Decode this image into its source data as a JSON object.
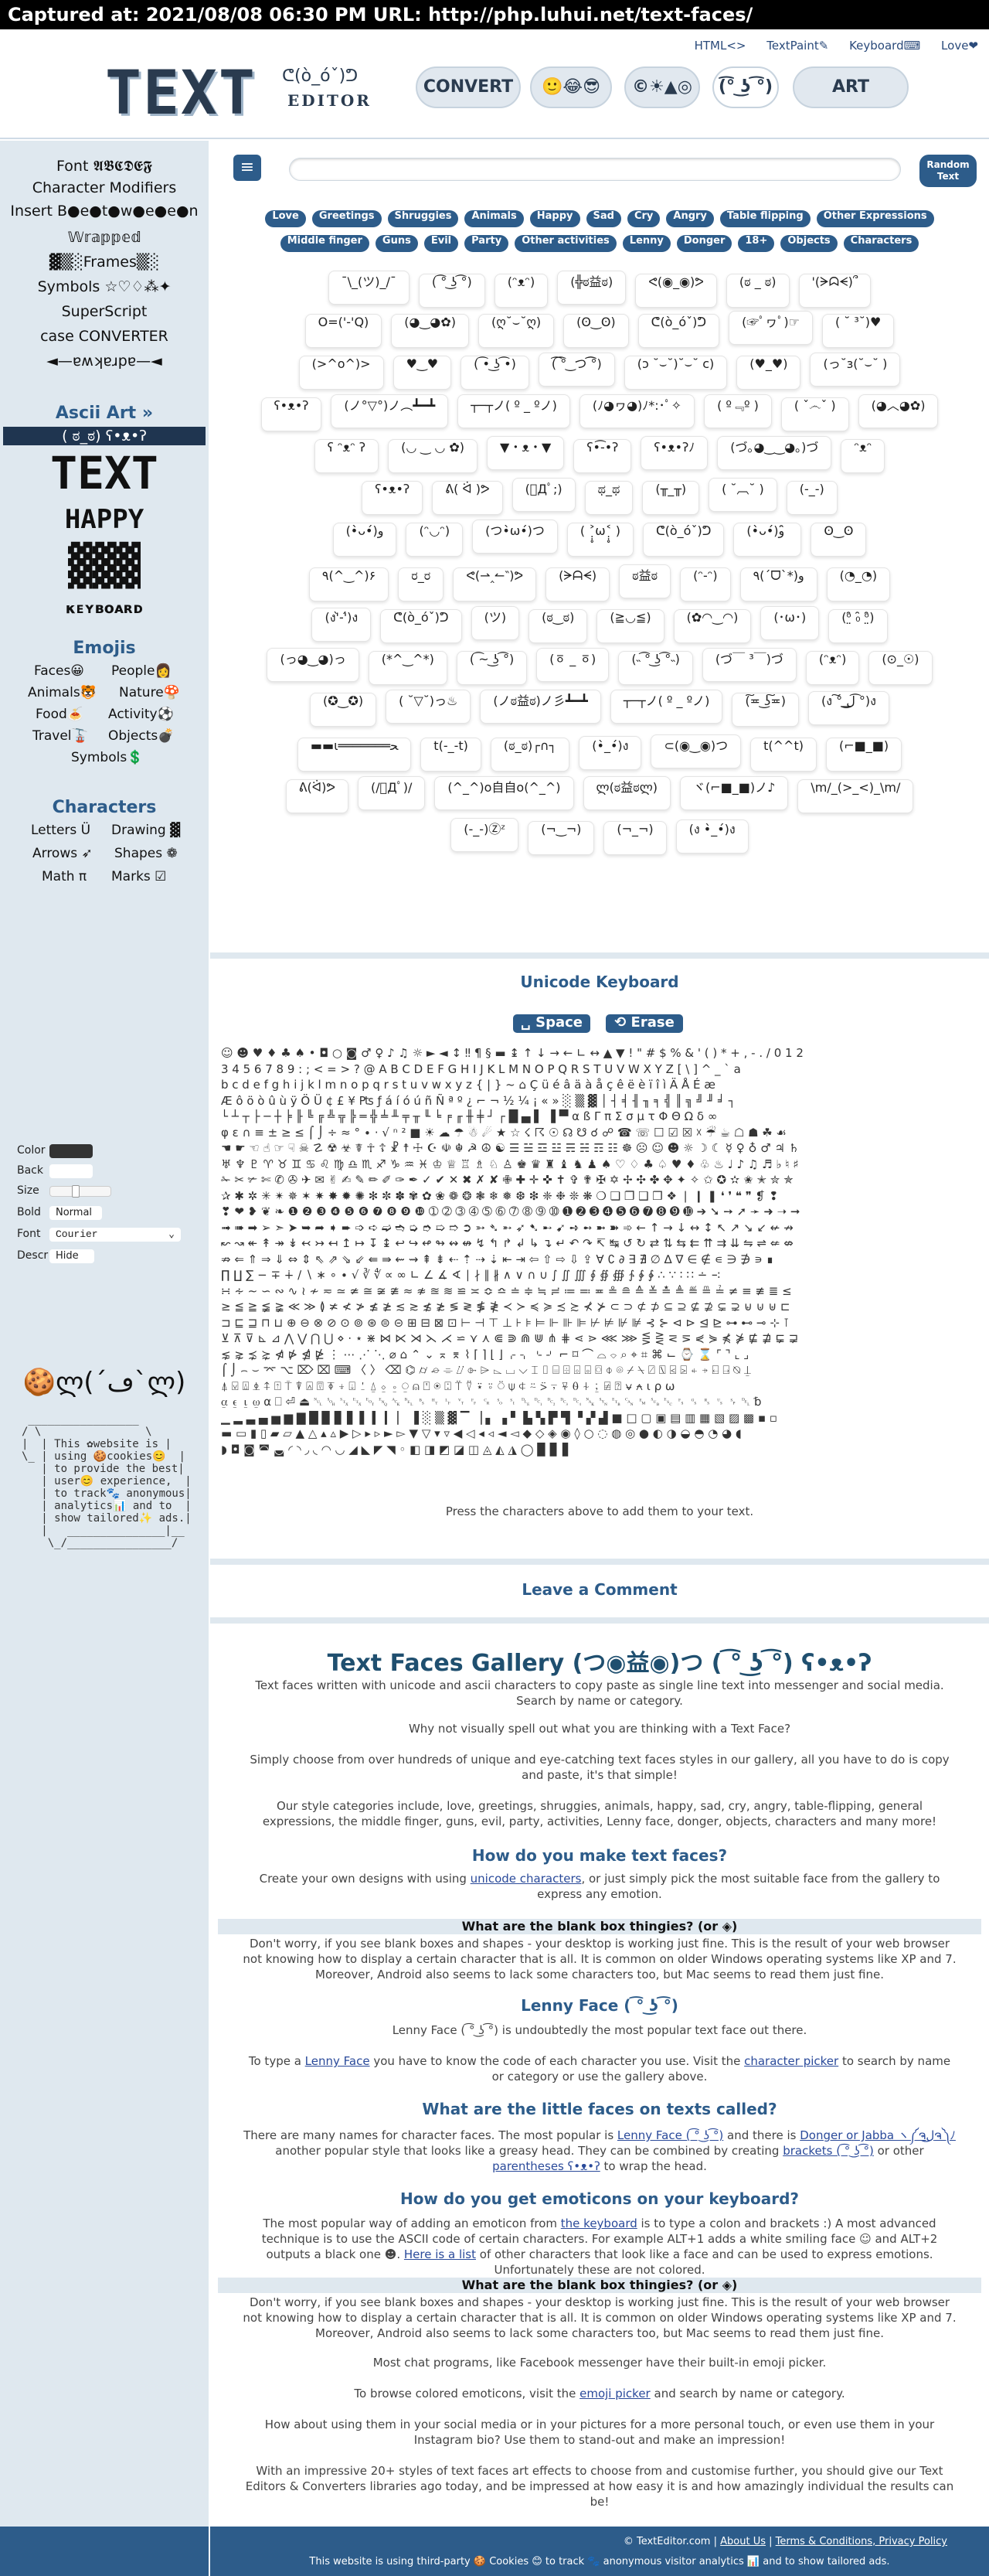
{
  "capture": {
    "text": "Captured at: 2021/08/08 06:30 PM    URL: http://php.luhui.net/text-faces/"
  },
  "header": {
    "links": [
      "HTML<>",
      "TextPaint✎",
      "Keyboard⌨",
      "Love❤"
    ],
    "logo_main": "TEXT",
    "logo_face": "ᕦ(ò_óˇ)ᕤ",
    "logo_sub": "EDITOR",
    "nav": [
      "CONVERT",
      "🙂😂😎",
      "©☀▲◎",
      "(͡° ͜ʖ ͡°)",
      "ART"
    ]
  },
  "sidebar": {
    "modifiers": [
      "Font 𝕬𝕭𝕮𝕯𝕰𝕱",
      "Character Modifiers",
      "Insert B●e●t●w●e●e●n",
      "𝕎𝕣𝕒𝕡𝕡𝕖𝕕",
      "▓▒░Frames▒░",
      "Symbols ☆♡♢⁂✦",
      "SuperScript",
      "case CONVERTER",
      "◄—ɐʍʞɐɹpɐ—◄"
    ],
    "ascii_title": "Ascii Art »",
    "ascii_highlight": "( ಠ_ಠ)  ʕ•ᴥ•ʔ",
    "ascii_items": [
      "TEXT",
      "HAPPY",
      "▓▓▓",
      "κᴇʏʙᴏᴀʀᴅ"
    ],
    "emojis_title": "Emojis",
    "emoji_items": [
      "Faces😀",
      "People👩",
      "Animals🐯",
      "Nature🍄",
      "Food🍝",
      "Activity⚽",
      "Travel🚡",
      "Objects💣",
      "Symbols💲"
    ],
    "chars_title": "Characters",
    "char_items": [
      "Letters Ü",
      "Drawing ▓",
      "Arrows ➶",
      "Shapes ❁",
      "Math π",
      "Marks ☑"
    ],
    "controls": {
      "color_label": "Color",
      "back_label": "Back",
      "size_label": "Size",
      "bold_label": "Bold",
      "bold_value": "Normal",
      "font_label": "Font",
      "font_value": "Courier",
      "descr_label": "Descr",
      "descr_value": "Hide"
    },
    "cookie_face": "🍪ლ(´ڡ`ლ)",
    "cookie_text": " _________________\n/ \\                \\\n|  | This ✿website is |\n\\_ | using 🍪cookies😊  |\n   | to provide the best|\n   | user😊 experience,  |\n   | to track🐾 anonymous|\n   | analytics📊 and to  |\n   | show tailored✨ ads.|\n   |   _______________|__\n    \\_/________________/"
  },
  "search": {
    "placeholder": ""
  },
  "random_button": "Random Text",
  "tags_row1": [
    "Love",
    "Greetings",
    "Shruggies",
    "Animals",
    "Happy",
    "Sad",
    "Cry",
    "Angry",
    "Table flipping",
    "Other Expressions"
  ],
  "tags_row2": [
    "Middle finger",
    "Guns",
    "Evil",
    "Party",
    "Other activities",
    "Lenny",
    "Donger",
    "18+",
    "Objects",
    "Characters"
  ],
  "faces": [
    [
      "¯\\_(ツ)_/¯",
      "( ͡° ͜ʖ ͡°)",
      "(ᵔᴥᵔ)",
      "(╬ಠ益ಠ)",
      "ᕙ(◉_◉)ᕗ",
      "(ಠ _ ಠ)",
      "'(ᗒᗣᗕ)՞"
    ],
    [
      "O=('-'Q)",
      "(◕‿◕✿)",
      "(ღ˘⌣˘ღ)",
      "(ʘ‿ʘ)",
      "ᕦ(ò_óˇ)ᕤ",
      "(☞ﾟヮﾟ)☞",
      "( ˘ ³˘)♥"
    ],
    [
      "(>^o^)>",
      "♥‿♥",
      "( ͡• ͜ʖ ͡•)",
      "(͡ ͡° ͜ つ ͡͡°)",
      "(ɔ ˘⌣˘)˘⌣˘ c)",
      "(♥_♥)",
      "(っ˘з(˘⌣˘ )"
    ],
    [
      "ʕ•ᴥ•ʔ",
      "(ノ°▽°)ノ︵┻━┻",
      "┬─┬ノ( º _ ºノ)",
      "(ﾉ◕ヮ◕)ﾉ*:･ﾟ✧",
      "( º﹃º )",
      "( ˇ෴ˇ )",
      "(◕︿◕✿)"
    ],
    [
      "ʕ ᵔᴥᵔ ʔ",
      "(◡ ‿ ◡ ✿)",
      "▼・ᴥ・▼",
      "ʕ•͡-•ʔ",
      "ʕ•ᴥ•ʔﾉ",
      "(づ｡◕‿‿◕｡)づ",
      "ᵔᴥᵔ"
    ],
    [
      "ʕ•ᴥ•ʔ",
      "ᕕ( ᐛ )ᕗ",
      "(ﾟДﾟ;)",
      "ಥ_ಥ",
      "(╥_╥)",
      "( ˘︹˘ )",
      "(-_-)"
    ],
    [
      "(•̀ᴗ•́)و",
      "(ᵔ◡ᵔ)",
      "(つ•̀ω•́)つ",
      "( ˃̣̣̥ω˂̣̣̥ )",
      "ᕦ(ò_óˇ)ᕤ",
      "(•̀ᴗ•́)و ̑̑",
      "ʘ‿ʘ"
    ],
    [
      "٩(^‿^)۶",
      "ರ_ರ",
      "ᕙ(⇀‸↼‶)ᕗ",
      "(ᗒᗩᗕ)",
      "ಠ益ಠ",
      "(ᵔ-ᵔ)",
      "٩(ˊᗜˋ*)و",
      "(◔_◔)"
    ],
    [
      "(ง'̀-'́)ง",
      "ᕦ(ò_óˇ)ᕤ",
      "(ツ)",
      "(ಠ‿ಠ)",
      "(≧◡≦)",
      "(✿◠‿◠)",
      "(･ω･)",
      "(ᵒ̤̑ ₀̑ ᵒ̤̑)"
    ],
    [
      "(っ◕‿◕)っ",
      "(*^‿^*)",
      "( ͡~ ͜ʖ ͡°)",
      "(ㆆ _ ㆆ)",
      "(˵ ͡° ͜ʖ ͡°˵)",
      "(づ￣ ³￣)づ",
      "(ᵔᴥᵔ)",
      "(⊙_☉)"
    ],
    [
      "(✪‿✪)",
      "( ˘▽˘)っ♨",
      "(ノಠ益ಠ)ノ彡┻━┻",
      "┬─┬ノ( º _ ºノ)",
      "(͠≖ ͜ʖ͠≖)",
      "(ง ͠° ͟ل͜ ͡°)ง"
    ],
    [
      "▬▬ι═══════ﺤ",
      "t(-_-t)",
      "(ಠ_ಠ)┌∩┐",
      "(•̀_•́)ง",
      "⊂(◉‿◉)つ",
      "t(^^t)",
      "(⌐■_■)"
    ],
    [
      "ᕕ(ᐛ)ᕗ",
      "(/ﾟДﾟ)/",
      "(^_^)o自自o(^_^)",
      "ლ(ಠ益ಠლ)",
      "ヾ(⌐■_■)ノ♪",
      "\\m/_(>_<)_\\m/"
    ],
    [
      "(-_-)Ⓩᶻ",
      "(¬‿¬)",
      "(¬_¬)",
      "(ง •̀_•́)ง"
    ]
  ],
  "keyboard": {
    "title": "Unicode Keyboard",
    "space_label": "␣ Space",
    "erase_label": "⟲ Erase",
    "chars": "☺ ☻ ♥ ♦ ♣ ♠ • ◘ ○ ◙ ♂ ♀ ♪ ♫ ☼ ► ◄ ↕ ‼ ¶ § ▬ ↨ ↑ ↓ → ← ∟ ↔ ▲ ▼ ! \" # $ % & ' ( ) * + , - . / 0 1 2\n3 4 5 6 7 8 9 : ; < = > ? @ A B C D E F G H I J K L M N O P Q R S T U V W X Y Z [ \\ ] ^ _ ` a\nb c d e f g h i j k l m n o p q r s t u v w x y z { | } ~ ⌂ Ç ü é â ä à å ç ê ë è ï î ì Ä Å É æ\nÆ ô ö ò û ù ÿ Ö Ü ¢ £ ¥ ₧ ƒ á í ó ú ñ Ñ ª º ¿ ⌐ ¬ ½ ¼ ¡ « » ░ ▒ ▓ │ ┤ ╡ ╢ ╖ ╕ ╣ ║ ╗ ╝ ╜ ╛ ┐\n└ ┴ ┬ ├ ─ ┼ ╞ ╟ ╚ ╔ ╩ ╦ ╠ ═ ╬ ╧ ╨ ╤ ╥ ╙ ╘ ╒ ╓ ╫ ╪ ┘ ┌ █ ▄ ▌ ▐ ▀ α ß Γ π Σ σ µ τ Φ Θ Ω δ ∞\nφ ε ∩ ≡ ± ≥ ≤ ⌠ ⌡ ÷ ≈ ° ∙ · √ ⁿ ² ■ ☀ ☁ ☂ ☃ ☄ ★ ☆ ☇ ☈ ☉ ☊ ☋ ☌ ☍ ☎ ☏ ☐ ☑ ☒ ☓ ☔ ☕ ☖ ☗ ☘ ☙\n☚ ☛ ☜ ☝ ☞ ☟ ☠ ☡ ☢ ☣ ☤ ☥ ☦ ☧ ☨ ☩ ☪ ☫ ☬ ☭ ☮ ☯ ☰ ☱ ☲ ☳ ☴ ☵ ☶ ☷ ☸ ☹ ☺ ☻ ☼ ☽ ☾ ☿ ♀ ♁ ♂ ♃ ♄\n♅ ♆ ♇ ♈ ♉ ♊ ♋ ♌ ♍ ♎ ♏ ♐ ♑ ♒ ♓ ♔ ♕ ♖ ♗ ♘ ♙ ♚ ♛ ♜ ♝ ♞ ♟ ♠ ♡ ♢ ♣ ♤ ♥ ♦ ♧ ♨ ♩ ♪ ♫ ♬ ♭ ♮ ♯\n✁ ✂ ✃ ✄ ✆ ✇ ✈ ✉ ✌ ✍ ✎ ✏ ✐ ✑ ✒ ✓ ✔ ✕ ✖ ✗ ✘ ✙ ✚ ✛ ✜ ✝ ✞ ✟ ✠ ✡ ✢ ✣ ✤ ✥ ✦ ✧ ✩ ✪ ✫ ✬ ✭ ✮ ✯\n✰ ✱ ✲ ✳ ✴ ✵ ✶ ✷ ✸ ✹ ✺ ✻ ✼ ✽ ✾ ✿ ❀ ❁ ❂ ❃ ❄ ❅ ❆ ❇ ❈ ❉ ❊ ❋ ❍ ❏ ❐ ❑ ❒ ❖ ❘ ❙ ❚ ❛ ❜ ❝ ❞ ❡ ❢\n❣ ❤ ❥ ❦ ❧ ❶ ❷ ❸ ❹ ❺ ❻ ❼ ❽ ❾ ❿ ➀ ➁ ➂ ➃ ➄ ➅ ➆ ➇ ➈ ➉ ➊ ➋ ➌ ➍ ➎ ➏ ➐ ➑ ➒ ➓ ➔ ➘ ➙ ➚ ➛ ➜ ➝ ➞\n➟ ➠ ➡ ➢ ➣ ➤ ➥ ➦ ➧ ➨ ➩ ➪ ➫ ➬ ➭ ➮ ➯ ➱ ➲ ➳ ➴ ➵ ➶ ➷ ➸ ➹ ➺ ➻ ➼ ➽ ➾ ← ↑ → ↓ ↔ ↕ ↖ ↗ ↘ ↙ ↚ ↛\n↜ ↝ ↞ ↟ ↠ ↡ ↢ ↣ ↤ ↥ ↦ ↧ ↨ ↩ ↪ ↫ ↬ ↭ ↮ ↯ ↰ ↱ ↲ ↳ ↴ ↵ ↶ ↷ ↸ ↹ ↺ ↻ ⇄ ⇅ ⇆ ⇇ ⇈ ⇉ ⇊ ⇋ ⇌ ⇍ ⇎\n⇏ ⇐ ⇑ ⇒ ⇓ ⇔ ⇕ ⇖ ⇗ ⇘ ⇙ ⇚ ⇛ ⇜ ⇝ ⇞ ⇟ ⇠ ⇡ ⇢ ⇣ ⇤ ⇥ ⇦ ⇧ ⇨ ⇩ ⇪ ∀ ∁ ∂ ∃ ∄ ∅ ∆ ∇ ∈ ∉ ∊ ∋ ∌ ∍ ∎\n∏ ∐ ∑ − ∓ ∔ ∕ ∖ ∗ ∘ ∙ √ ∛ ∜ ∝ ∞ ∟ ∠ ∡ ∢ ∣ ∤ ∥ ∦ ∧ ∨ ∩ ∪ ∫ ∬ ∭ ∮ ∯ ∰ ∱ ∲ ∳ ∴ ∵ ∶ ∷ ∸ ∹\n∺ ∻ ∼ ∽ ∾ ∿ ≀ ≁ ≂ ≃ ≄ ≅ ≆ ≇ ≈ ≉ ≊ ≋ ≌ ≍ ≎ ≏ ≐ ≑ ≒ ≓ ≔ ≕ ≖ ≗ ≘ ≙ ≚ ≛ ≜ ≝ ≞ ≟ ≠ ≡ ≢ ≣ ≤\n≥ ≦ ≧ ≨ ≩ ≪ ≫ ≬ ≭ ≮ ≯ ≰ ≱ ≲ ≳ ≴ ≵ ≶ ≷ ≸ ≹ ≺ ≻ ≼ ≽ ≾ ≿ ⊀ ⊁ ⊂ ⊃ ⊄ ⊅ ⊆ ⊇ ⊈ ⊉ ⊊ ⊋ ⊌ ⊍ ⊎ ⊏\n⊐ ⊑ ⊒ ⊓ ⊔ ⊕ ⊖ ⊗ ⊘ ⊙ ⊚ ⊛ ⊜ ⊝ ⊞ ⊟ ⊠ ⊡ ⊢ ⊣ ⊤ ⊥ ⊦ ⊧ ⊨ ⊩ ⊪ ⊫ ⊬ ⊭ ⊮ ⊯ ⊰ ⊱ ⊲ ⊳ ⊴ ⊵ ⊶ ⊷ ⊸ ⊹ ⊺\n⊻ ⊼ ⊽ ⊾ ⊿ ⋀ ⋁ ⋂ ⋃ ⋄ ⋅ ⋆ ⋇ ⋈ ⋉ ⋊ ⋋ ⋌ ⋍ ⋎ ⋏ ⋐ ⋑ ⋒ ⋓ ⋔ ⋕ ⋖ ⋗ ⋘ ⋙ ⋚ ⋛ ⋜ ⋝ ⋞ ⋟ ⋠ ⋡ ⋢ ⋣ ⋤ ⋥\n⋦ ⋧ ⋨ ⋩ ⋪ ⋫ ⋬ ⋭ ⋮ ⋯ ⋰ ⋱ ⌀ ⌂ ⌃ ⌄ ⌅ ⌆ ⌇ ⌈ ⌉ ⌊ ⌋ ⌌ ⌍ ⌎ ⌏ ⌐ ⌑ ⌒ ⌓ ⌔ ⌕ ⌖ ⌗ ⌘ ⌙ ⌚ ⌛ ⌜ ⌝ ⌞ ⌟\n⌠ ⌡ ⌢ ⌣ ⌤ ⌥ ⌦ ⌧ ⌨ 〈 〉 ⌫ ⌬ ⌭ ⌮ ⌯ ⌰ ⌱ ⌲ ⌳ ⌴ ⌵ ⌶ ⌷ ⌸ ⌹ ⌺ ⌻ ⌼ ⌽ ⌾ ⌿ ⍀ ⍁ ⍂ ⍃ ⍄ ⍅ ⍆ ⍇ ⍈ ⍉ ⍊\n⍋ ⍌ ⍍ ⍎ ⍏ ⍐ ⍑ ⍒ ⍓ ⍔ ⍕ ⍖ ⍗ ⍘ ⍙ ⍚ ⍛ ⍜ ⍝ ⍞ ⍟ ⍠ ⍡ ⍢ ⍣ ⍤ ⍥ ⍦ ⍧ ⍨ ⍩ ⍪ ⍫ ⍬ ⍭ ⍮ ⍯ ⍰ ⍱ ⍲ ⍳ ⍴ ⍵\n⍶ ⍷ ⍸ ⍹ ⍺ ⎕ ⏎ ⏏ ␀ ␁ ␂ ␃ ␄ ␅ ␆ ␇ ␈ ␉ ␊ ␋ ␌ ␍ ␎ ␏ ␐ ␑ ␒ ␓ ␔ ␕ ␖ ␗ ␘ ␙ ␚ ␛ ␜ ␝ ␞ ␟ ␠ ␡ ␢\n▁ ▂ ▃ ▄ ▅ ▆ ▇ █ ▉ ▊ ▋ ▌ ▍ ▎ ▏ ▐ ░ ▒ ▓ ▔ ▕ ▖ ▗ ▘ ▙ ▚ ▛ ▜ ▝ ▞ ▟ ■ □ ▢ ▣ ▤ ▥ ▦ ▧ ▨ ▩ ▪ ▫\n▬ ▭ ▮ ▯ ▰ ▱ ▲ △ ▴ ▵ ▶ ▷ ▸ ▹ ► ▻ ▼ ▽ ▾ ▿ ◀ ◁ ◂ ◃ ◄ ◅ ◆ ◇ ◈ ◉ ◊ ○ ◌ ◍ ◎ ● ◐ ◑ ◒ ◓ ◔ ◕ ◖\n◗ ◘ ◙ ◚ ◛ ◜ ◝ ◞ ◟ ◠ ◡ ◢ ◣ ◤ ◥ ◦ ◧ ◨ ◩ ◪ ◫ ◬ ◭ ◮ ◯ ▉ ▊ ▋",
    "note": "Press the characters above to add them to your text."
  },
  "comment_title": "Leave a Comment",
  "gallery": {
    "title": "Text Faces Gallery (つ◉益◉)つ ( ͡° ͜ʖ ͡°) ʕ•ᴥ•ʔ",
    "p1": "Text faces written with unicode and ascii characters to copy paste as single line text into messenger and social media. Search by name or category.",
    "p2": "Why not visually spell out what you are thinking with a Text Face?",
    "p3": "Simply choose from over hundreds of unique and eye-catching text faces styles in our gallery, all you have to do is copy and paste, it's that simple!",
    "p4": "Our style categories include, love, greetings, shruggies, animals, happy, sad, cry, angry, table-flipping, general expressions, the middle finger, guns, evil, party, activities, Lenny face, donger, objects, characters and many more!",
    "h_make": "How do you make text faces?",
    "p_make_1": "Create your own designs with using ",
    "p_make_link": "unicode characters",
    "p_make_2": ", or just simply pick the most suitable face from the gallery to express any emotion.",
    "h_blank": "What are the blank box thingies? (or ◈)",
    "p_blank": "Don't worry, if you see blank boxes and shapes - your desktop is working just fine. This is the result of your web browser not knowing how to display a certain character that is all. It is common on older Windows operating systems like XP and 7. Moreover, Android also seems to lack some characters too, but Mac seems to read them just fine.",
    "h_lenny": "Lenny Face ( ͡° ͜ʖ ͡°)",
    "p_lenny1": "Lenny Face ( ͡° ͜ʖ ͡°) is undoubtedly the most popular text face out there.",
    "p_lenny2_a": "To type a ",
    "p_lenny2_link1": "Lenny Face",
    "p_lenny2_b": " you have to know the code of each character you use. Visit the ",
    "p_lenny2_link2": "character picker",
    "p_lenny2_c": " to search by name or category or use the gallery above.",
    "h_little": "What are the little faces on texts called?",
    "p_little_a": "There are many names for character faces. The most popular is ",
    "p_little_link1": "Lenny Face ( ͡° ͜ʖ ͡°)",
    "p_little_b": " and there is ",
    "p_little_link2": "Donger or Jabba ヽ༼ຈل͜ຈ༽ﾉ",
    "p_little_c": " another popular style that looks like a greasy head. They can be combined by creating ",
    "p_little_link3": "brackets ( ͡° ͜ʖ ͡°)",
    "p_little_d": " or other ",
    "p_little_link4": "parentheses ʕ•ᴥ•ʔ",
    "p_little_e": " to wrap the head.",
    "h_keyboard": "How do you get emoticons on your keyboard?",
    "p_kb_a": "The most popular way of adding an emoticon from ",
    "p_kb_link1": "the keyboard",
    "p_kb_b": " is to type a colon and brackets :) A most advanced technique is to use the ASCII code of certain characters. For example ALT+1 adds a white smiling face ☺ and ALT+2 outputs a black one ☻. ",
    "p_kb_link2": "Here is a list",
    "p_kb_c": " of other characters that look like a face and can be used to express emotions. Unfortunately these are not colored.",
    "h_blank2": "What are the blank box thingies? (or ◈)",
    "p_blank2": "Don't worry, if you see blank boxes and shapes - your desktop is working just fine. This is the result of your web browser not knowing how to display a certain character that is all. It is common on older Windows operating systems like XP and 7. Moreover, Android also seems to lack some characters too, but Mac seems to read them just fine.",
    "p_chat": "Most chat programs, like Facebook messenger have their built-in emoji picker.",
    "p_browse_a": "To browse colored emoticons, visit the ",
    "p_browse_link": "emoji picker",
    "p_browse_b": " and search by name or category.",
    "p_social": "How about using them in your social media or in your pictures for a more personal touch, or even use them in your Instagram bio? Use them to stand-out and make an impression!",
    "p_impressive": "With an impressive 20+ styles of text faces art effects to choose from and customise further, you should give our Text Editors & Converters libraries ago today, and be impressed at how easy it is and how amazingly individual the results can be!"
  },
  "footer": {
    "copyright": "© TextEditor.com",
    "links": [
      "About Us",
      "Terms & Conditions, Privacy Policy"
    ],
    "notice": "This website is using third-party 🍪 Cookies 😊 to track 🐾 anonymous visitor analytics 📊 and to show tailored ads."
  }
}
